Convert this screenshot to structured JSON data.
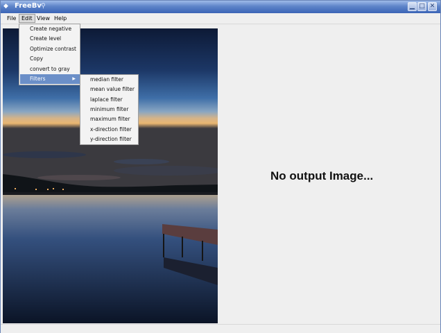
{
  "window": {
    "title": "FreeBv",
    "app_icon": "app-icon",
    "title_extra_icon": "pin-icon",
    "buttons": {
      "minimize": "minimize-icon",
      "maximize": "maximize-icon",
      "close": "close-icon"
    }
  },
  "menubar": {
    "items": [
      "File",
      "Edit",
      "View",
      "Help"
    ]
  },
  "edit_menu": {
    "items": [
      "Create negative",
      "Create level",
      "Optimize contrast",
      "Copy",
      "convert to gray",
      "Filters"
    ],
    "active_index": 5,
    "filters_has_submenu": true
  },
  "filters_menu": {
    "items": [
      "median filter",
      "mean value filter",
      "laplace filter",
      "minimum filter",
      "maximum filter",
      "x-direction filter",
      "y-direction filter"
    ]
  },
  "output": {
    "placeholder": "No output Image..."
  },
  "colors": {
    "titlebar": "#3a64b6",
    "menu_highlight": "#6b8fc8",
    "panel_bg": "#efefef"
  }
}
